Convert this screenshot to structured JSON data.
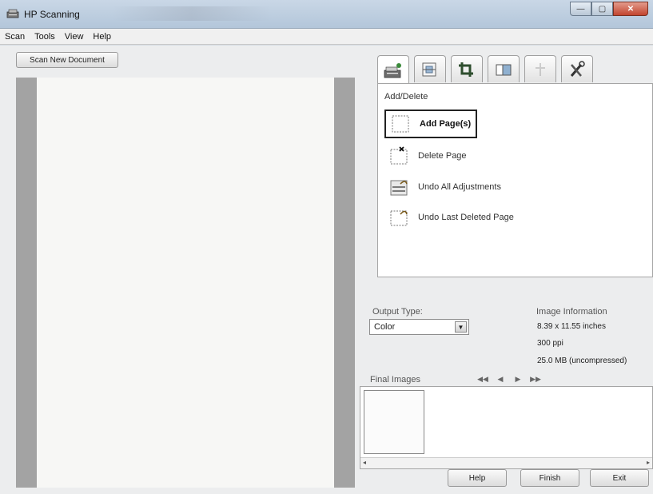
{
  "window": {
    "title": "HP Scanning",
    "minimize_icon": "minimize-icon",
    "maximize_icon": "maximize-icon",
    "close_icon": "close-icon"
  },
  "menu": [
    "Scan",
    "Tools",
    "View",
    "Help"
  ],
  "scan_new_button": "Scan New Document",
  "tool_tabs": [
    {
      "icon": "add-delete-icon",
      "active": true
    },
    {
      "icon": "flatbed-icon",
      "active": false
    },
    {
      "icon": "crop-icon",
      "active": false
    },
    {
      "icon": "page-size-icon",
      "active": false
    },
    {
      "icon": "adjust-icon",
      "active": false,
      "disabled": true
    },
    {
      "icon": "tools-icon",
      "active": false
    }
  ],
  "panel": {
    "title": "Add/Delete",
    "actions": [
      {
        "label": "Add Page(s)",
        "icon": "add-page-icon",
        "highlighted": true
      },
      {
        "label": "Delete Page",
        "icon": "delete-page-icon",
        "highlighted": false
      },
      {
        "label": "Undo All Adjustments",
        "icon": "undo-adjustments-icon",
        "highlighted": false
      },
      {
        "label": "Undo Last Deleted Page",
        "icon": "undo-deleted-page-icon",
        "highlighted": false
      }
    ]
  },
  "output": {
    "label": "Output Type:",
    "value": "Color"
  },
  "image_info": {
    "title": "Image Information",
    "dimensions": "8.39 x 11.55 inches",
    "resolution": "300 ppi",
    "size": "25.0 MB (uncompressed)"
  },
  "final_images": {
    "label": "Final Images",
    "nav": [
      "◀◀",
      "◀",
      "▶",
      "▶▶"
    ]
  },
  "buttons": {
    "help": "Help",
    "finish": "Finish",
    "exit": "Exit"
  }
}
